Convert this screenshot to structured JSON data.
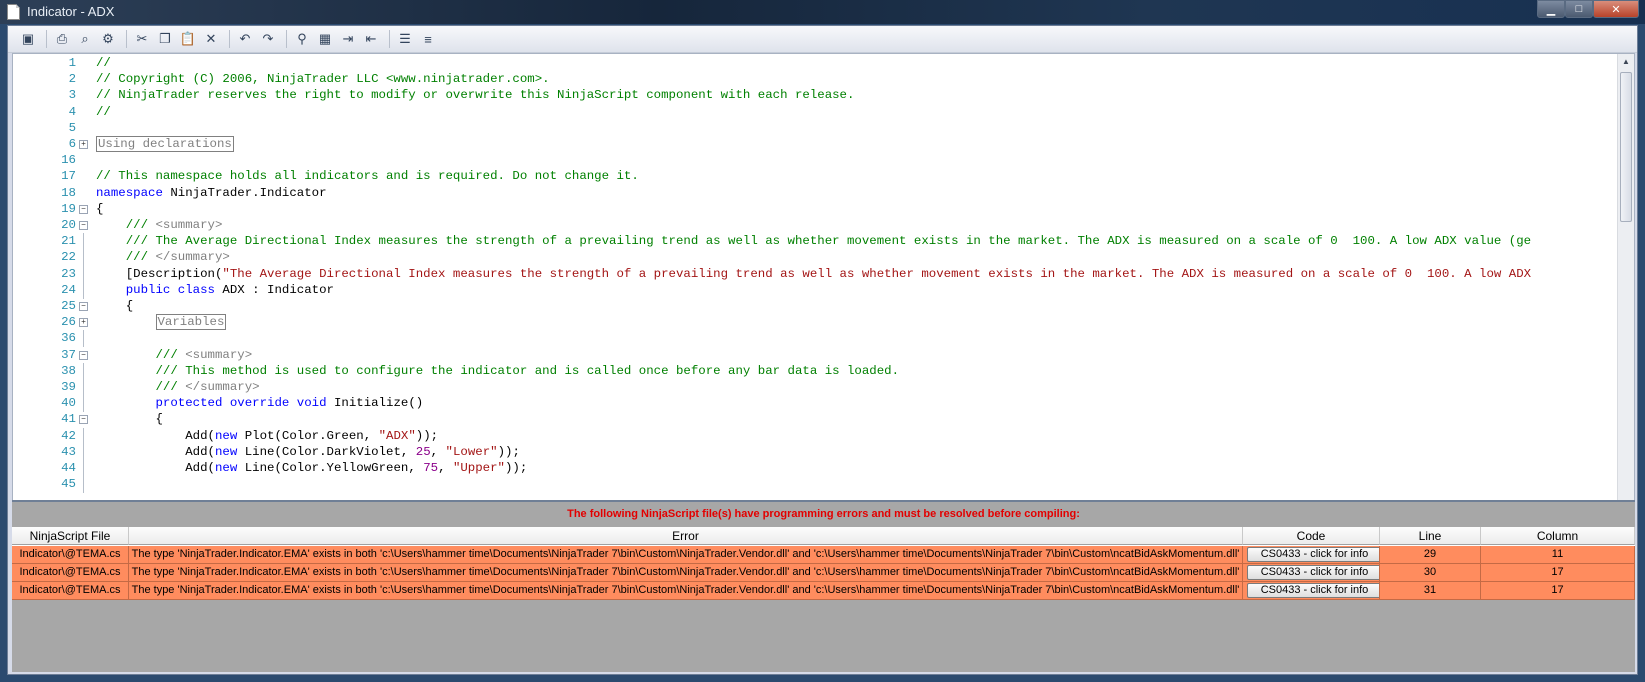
{
  "window": {
    "title": "Indicator - ADX"
  },
  "toolbar": {
    "icons": [
      "save-icon",
      "print-icon",
      "print-preview-icon",
      "page-setup-icon",
      "cut-icon",
      "copy-icon",
      "paste-icon",
      "delete-icon",
      "undo-icon",
      "redo-icon",
      "find-icon",
      "find-replace-icon",
      "indent-icon",
      "outdent-icon",
      "comment-icon",
      "uncomment-icon"
    ]
  },
  "editor": {
    "lines": [
      {
        "n": "1",
        "text": "//"
      },
      {
        "n": "2",
        "text": "// Copyright (C) 2006, NinjaTrader LLC <www.ninjatrader.com>."
      },
      {
        "n": "3",
        "text": "// NinjaTrader reserves the right to modify or overwrite this NinjaScript component with each release."
      },
      {
        "n": "4",
        "text": "//"
      },
      {
        "n": "5",
        "text": ""
      },
      {
        "n": "6",
        "text": "Using declarations"
      },
      {
        "n": "16",
        "text": ""
      },
      {
        "n": "17",
        "text": "// This namespace holds all indicators and is required. Do not change it."
      },
      {
        "n": "18",
        "kw": "namespace",
        "text": " NinjaTrader.Indicator"
      },
      {
        "n": "19",
        "text": "{"
      },
      {
        "n": "20",
        "xml1": "    /// ",
        "xml2": "<summary>"
      },
      {
        "n": "21",
        "text": "    /// The Average Directional Index measures the strength of a prevailing trend as well as whether movement exists in the market. The ADX is measured on a scale of 0  100. A low ADX value (ge"
      },
      {
        "n": "22",
        "xml1": "    /// ",
        "xml2": "</summary>"
      },
      {
        "n": "23",
        "pre": "    [Description(",
        "str": "\"The Average Directional Index measures the strength of a prevailing trend as well as whether movement exists in the market. The ADX is measured on a scale of 0  100. A low ADX"
      },
      {
        "n": "24",
        "kw": "    public class",
        "text": " ADX : Indicator"
      },
      {
        "n": "25",
        "text": "    {"
      },
      {
        "n": "26",
        "text": "Variables"
      },
      {
        "n": "36",
        "text": ""
      },
      {
        "n": "37",
        "xml1": "        /// ",
        "xml2": "<summary>"
      },
      {
        "n": "38",
        "text": "        /// This method is used to configure the indicator and is called once before any bar data is loaded."
      },
      {
        "n": "39",
        "xml1": "        /// ",
        "xml2": "</summary>"
      },
      {
        "n": "40",
        "kw": "        protected override void",
        "text": " Initialize()"
      },
      {
        "n": "41",
        "text": "        {"
      },
      {
        "n": "42",
        "a": "            Add(",
        "kw": "new",
        "b": " Plot(Color.Green, ",
        "str": "\"ADX\"",
        "c": "));"
      },
      {
        "n": "43",
        "a": "            Add(",
        "kw": "new",
        "b": " Line(Color.DarkViolet, ",
        "num": "25",
        "d": ", ",
        "str": "\"Lower\"",
        "c": "));"
      },
      {
        "n": "44",
        "a": "            Add(",
        "kw": "new",
        "b": " Line(Color.YellowGreen, ",
        "num": "75",
        "d": ", ",
        "str": "\"Upper\"",
        "c": "));"
      },
      {
        "n": "45",
        "text": ""
      }
    ]
  },
  "errors": {
    "message": "The following NinjaScript file(s) have programming errors and must be resolved before compiling:",
    "headers": [
      "NinjaScript File",
      "Error",
      "Code",
      "Line",
      "Column"
    ],
    "rows": [
      {
        "file": "Indicator\\@TEMA.cs",
        "error": "The type 'NinjaTrader.Indicator.EMA' exists in both 'c:\\Users\\hammer time\\Documents\\NinjaTrader 7\\bin\\Custom\\NinjaTrader.Vendor.dll' and 'c:\\Users\\hammer time\\Documents\\NinjaTrader 7\\bin\\Custom\\ncatBidAskMomentum.dll'",
        "code": "CS0433 - click for info",
        "line": "29",
        "column": "11"
      },
      {
        "file": "Indicator\\@TEMA.cs",
        "error": "The type 'NinjaTrader.Indicator.EMA' exists in both 'c:\\Users\\hammer time\\Documents\\NinjaTrader 7\\bin\\Custom\\NinjaTrader.Vendor.dll' and 'c:\\Users\\hammer time\\Documents\\NinjaTrader 7\\bin\\Custom\\ncatBidAskMomentum.dll'",
        "code": "CS0433 - click for info",
        "line": "30",
        "column": "17"
      },
      {
        "file": "Indicator\\@TEMA.cs",
        "error": "The type 'NinjaTrader.Indicator.EMA' exists in both 'c:\\Users\\hammer time\\Documents\\NinjaTrader 7\\bin\\Custom\\NinjaTrader.Vendor.dll' and 'c:\\Users\\hammer time\\Documents\\NinjaTrader 7\\bin\\Custom\\ncatBidAskMomentum.dll'",
        "code": "CS0433 - click for info",
        "line": "31",
        "column": "17"
      }
    ]
  }
}
